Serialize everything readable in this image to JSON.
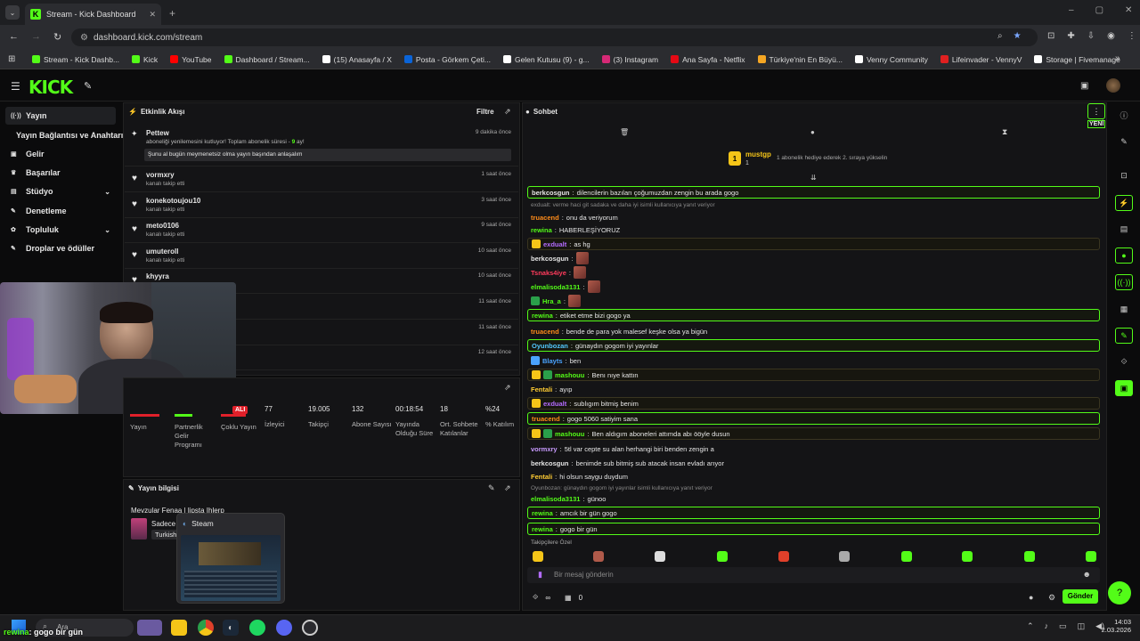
{
  "browser": {
    "tab_title": "Stream - Kick Dashboard",
    "url": "dashboard.kick.com/stream",
    "bookmarks": [
      {
        "label": "Stream - Kick Dashb...",
        "color": "#53fc18"
      },
      {
        "label": "Kick",
        "color": "#53fc18"
      },
      {
        "label": "YouTube",
        "color": "#ff0000"
      },
      {
        "label": "Dashboard / Stream...",
        "color": "#53fc18"
      },
      {
        "label": "(15) Anasayfa / X",
        "color": "#ffffff"
      },
      {
        "label": "Posta - Görkem Çeti...",
        "color": "#0a64d8"
      },
      {
        "label": "Gelen Kutusu (9) - g...",
        "color": "#ffffff"
      },
      {
        "label": "(3) Instagram",
        "color": "#d62976"
      },
      {
        "label": "Ana Sayfa - Netflix",
        "color": "#e50914"
      },
      {
        "label": "Türkiye'nin En Büyü...",
        "color": "#f5a623"
      },
      {
        "label": "Venny Community",
        "color": "#ffffff"
      },
      {
        "label": "Lifeinvader - VennyV",
        "color": "#e02020"
      },
      {
        "label": "Storage | Fivemanage",
        "color": "#ffffff"
      }
    ]
  },
  "sidebar": {
    "items": [
      {
        "label": "Yayın",
        "icon": "broadcast-icon"
      },
      {
        "label": "Yayın Bağlantısı ve Anahtarı",
        "icon": ""
      },
      {
        "label": "Gelir",
        "icon": "wallet-icon"
      },
      {
        "label": "Başarılar",
        "icon": "trophy-icon"
      },
      {
        "label": "Stüdyo",
        "icon": "studio-icon"
      },
      {
        "label": "Denetleme",
        "icon": "hammer-icon"
      },
      {
        "label": "Topluluk",
        "icon": "community-icon"
      },
      {
        "label": "Droplar ve ödüller",
        "icon": "gift-icon"
      }
    ]
  },
  "activity": {
    "title": "Etkinlik Akışı",
    "filter": "Filtre",
    "first": {
      "name": "Pettew",
      "text": "aboneliği yenilemesini kutluyor! Toplam abonelik süresi - ",
      "months": "9",
      "unit": " ay!",
      "message": "Şunu al bugün meymenetsiz olma yayın başından anlaşalım",
      "time": "9 dakika önce"
    },
    "events": [
      {
        "name": "vormxry",
        "sub": "kanalı takip etti",
        "time": "1 saat önce"
      },
      {
        "name": "konekotoujou10",
        "sub": "kanalı takip etti",
        "time": "3 saat önce"
      },
      {
        "name": "meto0106",
        "sub": "kanalı takip etti",
        "time": "9 saat önce"
      },
      {
        "name": "umuteroll",
        "sub": "kanalı takip etti",
        "time": "10 saat önce"
      },
      {
        "name": "khyyra",
        "sub": "",
        "time": "10 saat önce"
      },
      {
        "name": "",
        "sub": "",
        "time": "11 saat önce"
      },
      {
        "name": "",
        "sub": "",
        "time": "11 saat önce"
      },
      {
        "name": "",
        "sub": "",
        "time": "12 saat önce"
      }
    ]
  },
  "stats": {
    "live_badge": "ALI",
    "items": [
      {
        "value": "",
        "label": "Yayın"
      },
      {
        "value": "",
        "label": "Partnerlik Gelir Programı"
      },
      {
        "value": "",
        "label": "Çoklu Yayın"
      },
      {
        "value": "77",
        "label": "İzleyici"
      },
      {
        "value": "19.005",
        "label": "Takipçi"
      },
      {
        "value": "132",
        "label": "Abone Sayısı"
      },
      {
        "value": "00:18:54",
        "label": "Yayında Olduğu Süre"
      },
      {
        "value": "18",
        "label": "Ort. Sohbete Katılanlar"
      },
      {
        "value": "%24",
        "label": "% Katılım"
      }
    ]
  },
  "streaminfo": {
    "title": "Yayın bilgisi",
    "stream_title": "Mevzular Fenaa | lipsta Ihlerp",
    "category_short": "Sadece",
    "tag": "Turkish",
    "popup_title": "Steam"
  },
  "chat": {
    "title": "Sohbet",
    "new_label": "YENİ",
    "sub_user": "mustgp",
    "sub_count": "1",
    "sub_text": "1 abonelik hediye ederek 2. sıraya yükselin",
    "messages": [
      {
        "type": "hl",
        "user": "berkcosgun",
        "color": "#e6e6e6",
        "text": "dilencilerin bazıları çoğumuzdan zengin bu arada gogo",
        "reply": "exdualt: verme haci git sadaka ve daha iyi isimli kullanıcıya yanıt veriyor"
      },
      {
        "type": "",
        "user": "truacend",
        "color": "#ff8c1a",
        "text": "onu da veriyorum"
      },
      {
        "type": "",
        "user": "rewina",
        "color": "#53fc18",
        "text": "HABERLEŞİYORUZ"
      },
      {
        "type": "gl",
        "user": "exdualt",
        "color": "#b46cff",
        "text": "as hg"
      },
      {
        "type": "",
        "user": "berkcosgun",
        "color": "#e6e6e6",
        "text": ""
      },
      {
        "type": "",
        "user": "Tsnaks4iye",
        "color": "#ff3b5c",
        "text": ""
      },
      {
        "type": "",
        "user": "elmalisoda3131",
        "color": "#53fc18",
        "text": ""
      },
      {
        "type": "",
        "user": "Hra_a",
        "color": "#53fc18",
        "text": ""
      },
      {
        "type": "hl",
        "user": "rewina",
        "color": "#53fc18",
        "text": "etiket etme bizi gogo ya"
      },
      {
        "type": "",
        "user": "truacend",
        "color": "#ff8c1a",
        "text": "bende de para yok malesef keşke olsa ya bigün"
      },
      {
        "type": "hl",
        "user": "Oyunbozan",
        "color": "#53c8ff",
        "text": "günaydın gogom iyi yayınlar"
      },
      {
        "type": "",
        "user": "Blayts",
        "color": "#4aa3ff",
        "text": "ben"
      },
      {
        "type": "gl",
        "user": "mashouu",
        "color": "#53fc18",
        "text": "Benı nıye kattın"
      },
      {
        "type": "",
        "user": "Fentali",
        "color": "#ffcc33",
        "text": "ayıp"
      },
      {
        "type": "gl",
        "user": "exdualt",
        "color": "#b46cff",
        "text": "sublıgım bitmiş benim"
      },
      {
        "type": "hl",
        "user": "truacend",
        "color": "#ff8c1a",
        "text": "gogo 5060 satiyim sana"
      },
      {
        "type": "gl",
        "user": "mashouu",
        "color": "#53fc18",
        "text": "Ben aldıgım aboneleri attımda abı ööyle dusun"
      },
      {
        "type": "",
        "user": "vormxry",
        "color": "#c89bff",
        "text": "5tl var cepte su alan herhangi biri benden zengin a"
      },
      {
        "type": "",
        "user": "berkcosgun",
        "color": "#e6e6e6",
        "text": "benimde sub bitmiş sub atacak insan evladı arıyor"
      },
      {
        "type": "",
        "user": "Fentali",
        "color": "#ffcc33",
        "text": "hi olsun saygu duydum",
        "reply": "Oyunbozan: günaydın gogom iyi yayınlar isimli kullanıcıya yanıt veriyor"
      },
      {
        "type": "",
        "user": "elmalisoda3131",
        "color": "#53fc18",
        "text": "günoo"
      },
      {
        "type": "hl",
        "user": "rewina",
        "color": "#53fc18",
        "text": "amcık bir gün gogo"
      },
      {
        "type": "hl",
        "user": "rewina",
        "color": "#53fc18",
        "text": "gogo bir gün"
      }
    ],
    "emote_section": "Takipçilere Özel",
    "input_placeholder": "Bir mesaj gönderin",
    "points": "∞",
    "count": "0",
    "send": "Gönder"
  },
  "taskbar": {
    "search": "Ara",
    "time": "14:03",
    "date": "2.03.2026",
    "overlay_user": "rewina",
    "overlay_text": ": gogo bir gün"
  }
}
